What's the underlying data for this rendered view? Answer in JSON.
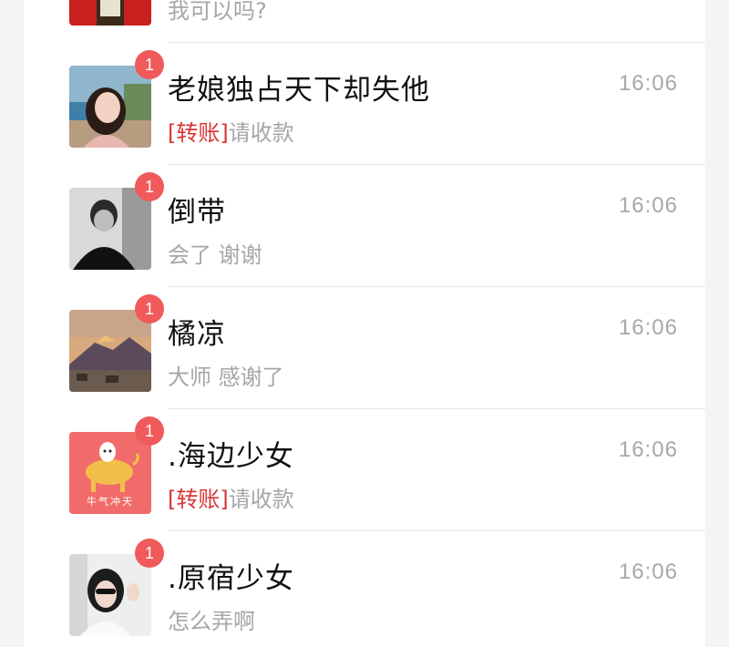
{
  "chats": [
    {
      "name": "",
      "preview_tag": "",
      "preview": "我可以吗?",
      "time": "",
      "badge": "",
      "avatar_icon": "avatar-red-photo"
    },
    {
      "name": "老娘独占天下却失他",
      "preview_tag": "[转账]",
      "preview": "请收款",
      "time": "16:06",
      "badge": "1",
      "avatar_icon": "avatar-woman-lake"
    },
    {
      "name": "倒带",
      "preview_tag": "",
      "preview": "会了 谢谢",
      "time": "16:06",
      "badge": "1",
      "avatar_icon": "avatar-man-bw"
    },
    {
      "name": "橘凉",
      "preview_tag": "",
      "preview": "大师 感谢了",
      "time": "16:06",
      "badge": "1",
      "avatar_icon": "avatar-mountain-sunset"
    },
    {
      "name": ".海边少女",
      "preview_tag": "[转账]",
      "preview": "请收款",
      "time": "16:06",
      "badge": "1",
      "avatar_icon": "avatar-cartoon-cow",
      "avatar_text": "牛气冲天"
    },
    {
      "name": ".原宿少女",
      "preview_tag": "",
      "preview": "怎么弄啊",
      "time": "16:06",
      "badge": "1",
      "avatar_icon": "avatar-girl-sunglasses"
    }
  ],
  "colors": {
    "badge": "#f05a5a",
    "transfer_tag": "#d93636",
    "time": "#a8a8a8",
    "preview": "#a6a6a6"
  }
}
